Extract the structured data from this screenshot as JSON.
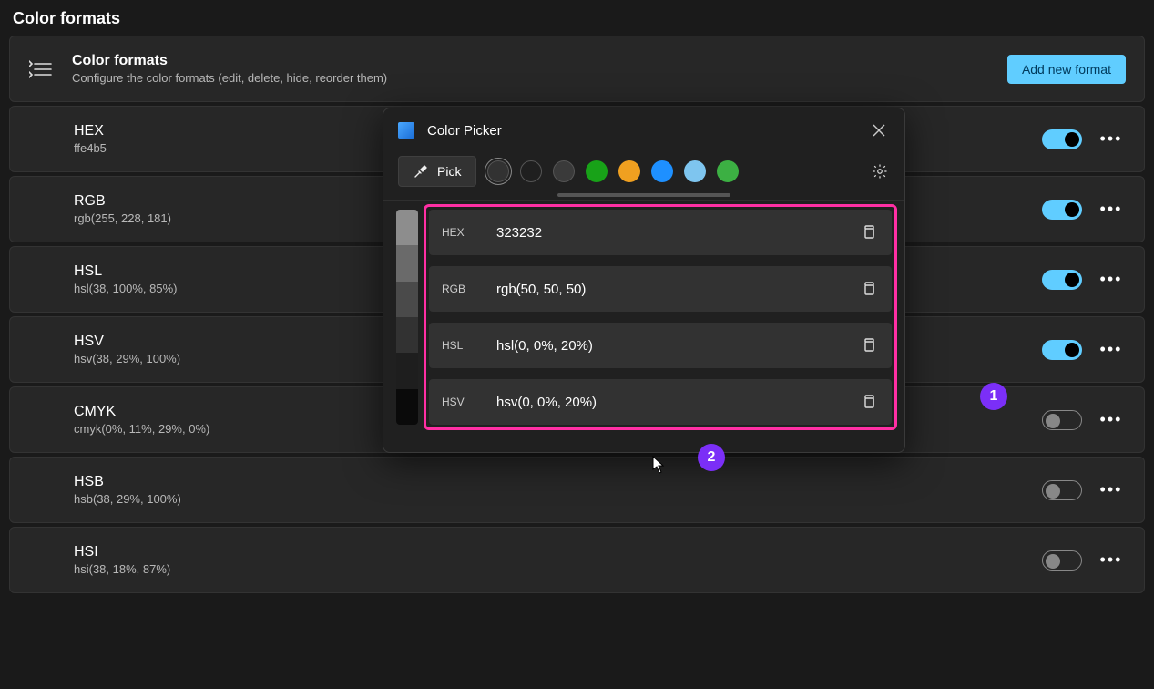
{
  "page_title": "Color formats",
  "header": {
    "title": "Color formats",
    "subtitle": "Configure the color formats (edit, delete, hide, reorder them)",
    "add_button": "Add new format"
  },
  "formats": [
    {
      "name": "HEX",
      "value": "ffe4b5",
      "enabled": true
    },
    {
      "name": "RGB",
      "value": "rgb(255, 228, 181)",
      "enabled": true
    },
    {
      "name": "HSL",
      "value": "hsl(38, 100%, 85%)",
      "enabled": true
    },
    {
      "name": "HSV",
      "value": "hsv(38, 29%, 100%)",
      "enabled": true
    },
    {
      "name": "CMYK",
      "value": "cmyk(0%, 11%, 29%, 0%)",
      "enabled": false
    },
    {
      "name": "HSB",
      "value": "hsb(38, 29%, 100%)",
      "enabled": false
    },
    {
      "name": "HSI",
      "value": "hsi(38, 18%, 87%)",
      "enabled": false
    }
  ],
  "picker": {
    "title": "Color Picker",
    "pick_label": "Pick",
    "swatches": [
      "#323232",
      "#1f1f1f",
      "#3a3a3a",
      "#18a218",
      "#f0a020",
      "#1e90ff",
      "#7ec5ef",
      "#3cb043"
    ],
    "selected_swatch": 0,
    "shades": [
      "#8d8d8d",
      "#6a6a6a",
      "#4a4a4a",
      "#323232",
      "#1e1e1e",
      "#0a0a0a"
    ],
    "values": [
      {
        "label": "HEX",
        "value": "323232"
      },
      {
        "label": "RGB",
        "value": "rgb(50, 50, 50)"
      },
      {
        "label": "HSL",
        "value": "hsl(0, 0%, 20%)"
      },
      {
        "label": "HSV",
        "value": "hsv(0, 0%, 20%)"
      }
    ]
  },
  "annotations": {
    "badge1": "1",
    "badge2": "2"
  }
}
